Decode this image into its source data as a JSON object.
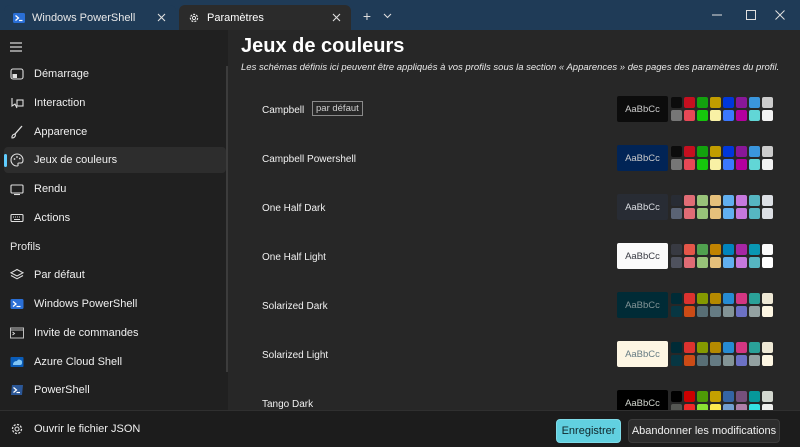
{
  "colors": {
    "accent": "#60cdff",
    "save_button": "#61d0e0",
    "titlebar": "#1f3b57"
  },
  "tabs": [
    {
      "title": "Windows PowerShell",
      "icon": "powershell-icon"
    },
    {
      "title": "Paramètres",
      "icon": "gear-icon"
    }
  ],
  "titlebar": {
    "new_tab": "+",
    "dropdown": "⌄"
  },
  "sidebar": {
    "items": [
      {
        "label": "Démarrage",
        "icon": "startup-icon"
      },
      {
        "label": "Interaction",
        "icon": "interaction-icon"
      },
      {
        "label": "Apparence",
        "icon": "brush-icon"
      },
      {
        "label": "Jeux de couleurs",
        "icon": "palette-icon",
        "selected": true
      },
      {
        "label": "Rendu",
        "icon": "monitor-icon"
      },
      {
        "label": "Actions",
        "icon": "keyboard-icon"
      }
    ],
    "profiles_header": "Profils",
    "profiles": [
      {
        "label": "Par défaut",
        "icon": "layers-icon"
      },
      {
        "label": "Windows PowerShell",
        "icon": "powershell-icon"
      },
      {
        "label": "Invite de commandes",
        "icon": "cmd-icon"
      },
      {
        "label": "Azure Cloud Shell",
        "icon": "azure-icon"
      },
      {
        "label": "PowerShell",
        "icon": "powershell-icon"
      }
    ],
    "open_json": "Ouvrir le fichier JSON"
  },
  "main": {
    "title": "Jeux de couleurs",
    "description": "Les schémas définis ici peuvent être appliqués à vos profils sous la section « Apparences » des pages des paramètres du profil.",
    "preview_text": "AaBbCc",
    "default_badge": "par défaut",
    "schemes": [
      {
        "name": "Campbell",
        "is_default": true,
        "bg": "#0c0c0c",
        "fg": "#cccccc",
        "palette": [
          "#0c0c0c",
          "#c50f1f",
          "#13a10e",
          "#c19c00",
          "#0037da",
          "#881798",
          "#3a96dd",
          "#cccccc",
          "#767676",
          "#e74856",
          "#16c60c",
          "#f9f1a5",
          "#3b78ff",
          "#b4009e",
          "#61d6d6",
          "#f2f2f2"
        ]
      },
      {
        "name": "Campbell Powershell",
        "is_default": false,
        "bg": "#012456",
        "fg": "#cccccc",
        "palette": [
          "#0c0c0c",
          "#c50f1f",
          "#13a10e",
          "#c19c00",
          "#0037da",
          "#881798",
          "#3a96dd",
          "#cccccc",
          "#767676",
          "#e74856",
          "#16c60c",
          "#f9f1a5",
          "#3b78ff",
          "#b4009e",
          "#61d6d6",
          "#f2f2f2"
        ]
      },
      {
        "name": "One Half Dark",
        "is_default": false,
        "bg": "#282c34",
        "fg": "#dcdfe4",
        "palette": [
          "#282c34",
          "#e06c75",
          "#98c379",
          "#e5c07b",
          "#61afef",
          "#c678dd",
          "#56b6c2",
          "#dcdfe4",
          "#5a6374",
          "#e06c75",
          "#98c379",
          "#e5c07b",
          "#61afef",
          "#c678dd",
          "#56b6c2",
          "#dcdfe4"
        ]
      },
      {
        "name": "One Half Light",
        "is_default": false,
        "bg": "#fafafa",
        "fg": "#383a42",
        "palette": [
          "#383a42",
          "#e45649",
          "#50a14f",
          "#c18301",
          "#0184bc",
          "#a626a4",
          "#0997b3",
          "#fafafa",
          "#4f525e",
          "#e06c75",
          "#98c379",
          "#e5c07b",
          "#61afef",
          "#c678dd",
          "#56b6c2",
          "#ffffff"
        ]
      },
      {
        "name": "Solarized Dark",
        "is_default": false,
        "bg": "#002b36",
        "fg": "#839496",
        "palette": [
          "#002b36",
          "#dc322f",
          "#859900",
          "#b58900",
          "#268bd2",
          "#d33682",
          "#2aa198",
          "#eee8d5",
          "#073642",
          "#cb4b16",
          "#586e75",
          "#657b83",
          "#839496",
          "#6c71c4",
          "#93a1a1",
          "#fdf6e3"
        ]
      },
      {
        "name": "Solarized Light",
        "is_default": false,
        "bg": "#fdf6e3",
        "fg": "#657b83",
        "palette": [
          "#002b36",
          "#dc322f",
          "#859900",
          "#b58900",
          "#268bd2",
          "#d33682",
          "#2aa198",
          "#eee8d5",
          "#073642",
          "#cb4b16",
          "#586e75",
          "#657b83",
          "#839496",
          "#6c71c4",
          "#93a1a1",
          "#fdf6e3"
        ]
      },
      {
        "name": "Tango Dark",
        "is_default": false,
        "bg": "#000000",
        "fg": "#d3d7cf",
        "palette": [
          "#000000",
          "#cc0000",
          "#4e9a06",
          "#c4a000",
          "#3465a4",
          "#75507b",
          "#06989a",
          "#d3d7cf",
          "#555753",
          "#ef2929",
          "#8ae234",
          "#fce94f",
          "#729fcf",
          "#ad7fa8",
          "#34e2e2",
          "#eeeeec"
        ]
      }
    ]
  },
  "footer": {
    "save_label": "Enregistrer",
    "discard_label": "Abandonner les modifications"
  }
}
